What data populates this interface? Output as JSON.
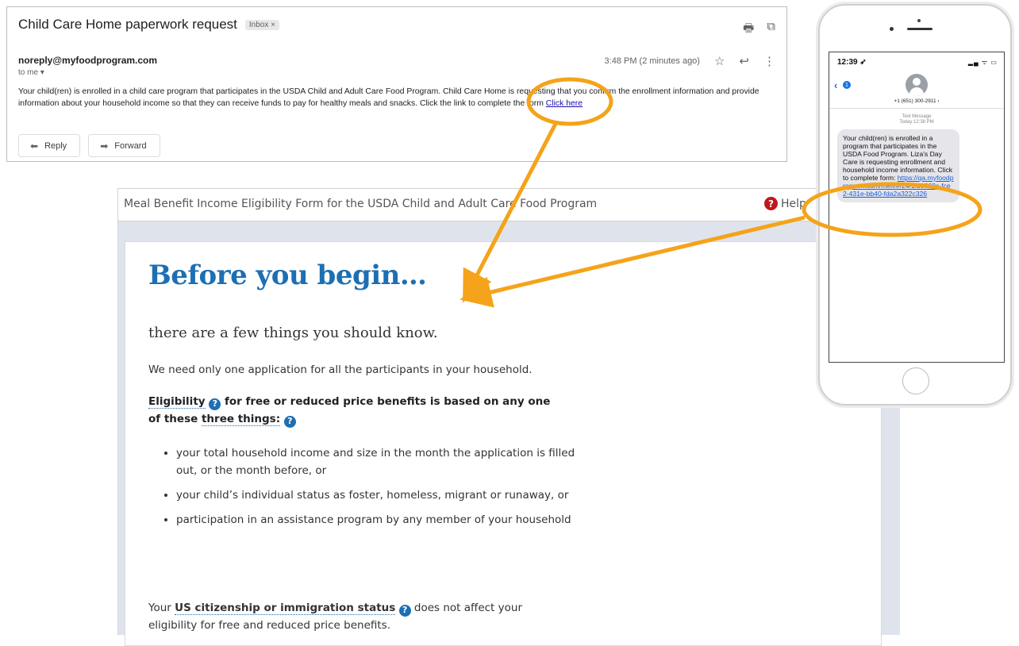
{
  "email": {
    "subject": "Child Care Home paperwork request",
    "badge": "Inbox ×",
    "sender": "noreply@myfoodprogram.com",
    "to": "to me ▾",
    "time": "3:48 PM (2 minutes ago)",
    "body_text": "Your child(ren) is enrolled in a child care program that participates in the USDA Child and Adult Care Food Program. Child Care Home is requesting that you confirm the enrollment information and provide information about your household income so that they can receive funds to pay for healthy meals and snacks. Click the link to complete the form",
    "link_text": "Click here",
    "reply_label": "Reply",
    "forward_label": "Forward"
  },
  "form": {
    "header_title": "Meal Benefit Income Eligibility Form for the USDA Child and Adult Care Food Program",
    "help_label": "Help",
    "title": "Before you begin…",
    "subtitle": "there are a few things you should know.",
    "para1": "We need only one application for all the participants in your household.",
    "eligibility_term": "Eligibility",
    "eligibility_mid": " for free or reduced price benefits is based on any one of these ",
    "three_things": "three things:",
    "bullets": [
      "your total household income and size in the month the application is filled out, or the month before, or",
      "your child’s individual status as foster, homeless, migrant or runaway, or",
      "participation in an assistance program by any member of your household"
    ],
    "citizen_prefix": "Your ",
    "citizen_term": "US citizenship or immigration status",
    "citizen_suffix": " does not affect your eligibility for free and reduced price benefits."
  },
  "phone": {
    "time": "12:39 ➶",
    "status_icons": "▂▄ ᯤ ▭",
    "back_badge": "1",
    "number": "+1 (651) 300-2911 ›",
    "stamp_line1": "Text Message",
    "stamp_line2": "Today 12:38 PM",
    "message": "Your child(ren) is enrolled in a program that participates in the USDA Food Program. Liza's Day Care is requesting enrollment and household income information. Click to complete form: ",
    "link": "https://qa.myfoodprogram.com/meif/#/24/1f50969c-fce2-431e-bb40-fda2a322c326"
  },
  "colors": {
    "callout": "#f5a31a",
    "title_blue": "#1d6fb3",
    "help_red": "#c0171d"
  }
}
